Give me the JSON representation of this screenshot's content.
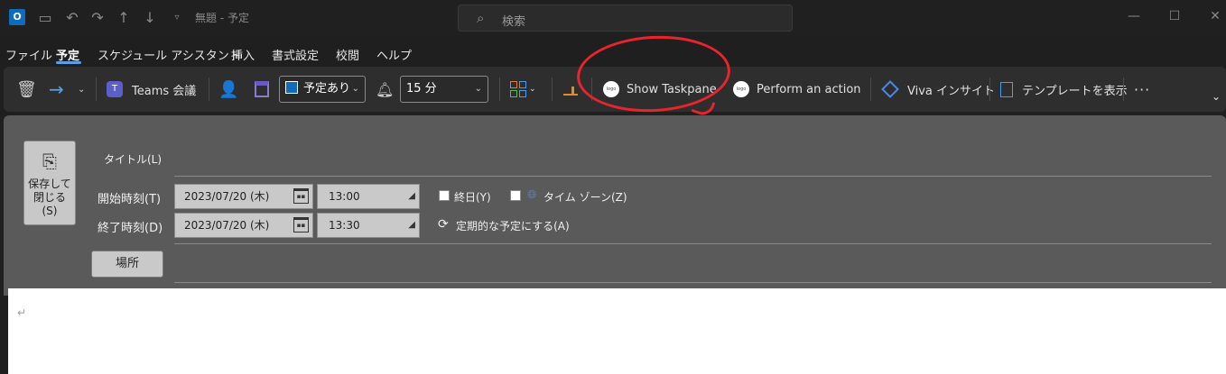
{
  "titlebar": {
    "app_icon_letter": "O",
    "title": "無題  -  予定",
    "search_placeholder": "検索"
  },
  "menu": {
    "items": [
      "ファイル",
      "予定",
      "スケジュール アシスタント",
      "挿入",
      "書式設定",
      "校閲",
      "ヘルプ"
    ],
    "active": "予定"
  },
  "ribbon": {
    "teams_label": "Teams 会議",
    "show_as_value": "予定あり",
    "reminder_value": "15 分",
    "show_taskpane_label": "Show Taskpane",
    "perform_action_label": "Perform an action",
    "logo_text": "logo",
    "viva_label": "Viva インサイト",
    "template_label": "テンプレートを表示",
    "more_label": "···"
  },
  "form": {
    "save_label_line1": "保存して",
    "save_label_line2": "閉じる",
    "save_label_line3": "(S)",
    "title_label": "タイトル(L)",
    "start_label": "開始時刻(T)",
    "end_label": "終了時刻(D)",
    "start_date": "2023/07/20 (木)",
    "start_time": "13:00",
    "end_date": "2023/07/20 (木)",
    "end_time": "13:30",
    "allday_label": "終日(Y)",
    "timezone_label": "タイム ゾーン(Z)",
    "recurring_label": "定期的な予定にする(A)",
    "location_label": "場所"
  },
  "body": {
    "pilcrow": "↵"
  },
  "colors": {
    "accent": "#5aa0e8",
    "annotation": "#e8242d",
    "teams": "#5b5fc7"
  }
}
